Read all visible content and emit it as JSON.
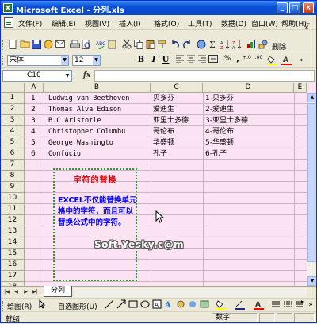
{
  "window": {
    "title": "Microsoft Excel - 分列.xls",
    "app_icon": "X",
    "controls": {
      "minimize": "_",
      "restore": "□",
      "close": "×"
    }
  },
  "menu": {
    "items": [
      "文件(F)",
      "编辑(E)",
      "视图(V)",
      "插入(I)",
      "格式(O)",
      "工具(T)",
      "数据(D)",
      "窗口(W)",
      "帮助(H)"
    ],
    "doc_controls": {
      "minimize": "_",
      "restore": "▫",
      "close": "×"
    }
  },
  "standard_toolbar": {
    "icons": [
      "new-icon",
      "open-icon",
      "save-icon",
      "permission-icon",
      "email-icon",
      "print-icon",
      "print-preview-icon",
      "spelling-icon",
      "research-icon",
      "cut-icon",
      "copy-icon",
      "paste-icon",
      "format-painter-icon",
      "undo-icon",
      "redo-icon",
      "hyperlink-icon",
      "autosum-icon",
      "sort-ascending-icon",
      "sort-descending-icon",
      "chart-wizard-icon",
      "drawing-icon"
    ],
    "extra_label": "删除"
  },
  "formatting_toolbar": {
    "font_name": "宋体",
    "font_size": "12",
    "bold": "B",
    "italic": "I",
    "underline": "U",
    "currency": "%",
    "comma": ",",
    "increase_decimal": "+.0",
    "decrease_decimal": ".00",
    "accent_fill": "#ffff00",
    "accent_font": "#ff0000"
  },
  "formula_bar": {
    "name_box": "C10",
    "fx": "fx",
    "formula": ""
  },
  "grid": {
    "columns": [
      "A",
      "B",
      "C",
      "D",
      "E"
    ],
    "rows": [
      "1",
      "2",
      "3",
      "4",
      "5",
      "6",
      "7",
      "8",
      "9",
      "10",
      "11",
      "12",
      "13",
      "14",
      "15",
      "16",
      "17",
      "18"
    ],
    "data": [
      {
        "a": "1",
        "b": "Ludwig van Beethoven",
        "c": "贝多芬",
        "d": "1-贝多芬"
      },
      {
        "a": "2",
        "b": "Thomas Alva Edison",
        "c": "爱迪生",
        "d": "2-爱迪生"
      },
      {
        "a": "3",
        "b": "B.C.Aristotle",
        "c": "亚里士多德",
        "d": "3-亚里士多德"
      },
      {
        "a": "4",
        "b": "Christopher Columbu",
        "c": "哥伦布",
        "d": "4-哥伦布"
      },
      {
        "a": "5",
        "b": "George Washingto",
        "c": "华盛顿",
        "d": "5-华盛顿"
      },
      {
        "a": "6",
        "b": "Confuciu",
        "c": "孔子",
        "d": "6-孔子"
      }
    ],
    "background": "#fbe3f4"
  },
  "textbox": {
    "title": "字符的替换",
    "body": "EXCEL不仅能替换单元格中的字符，而且可以替换公式中的字符。",
    "title_color": "#e00000",
    "body_color": "#0000ff",
    "border_color": "#2a9a2a"
  },
  "watermark": "Soft.Yesky.c@m",
  "sheet_tabs": {
    "nav": [
      "|◀",
      "◀",
      "▶",
      "▶|"
    ],
    "active": "分列"
  },
  "drawing_toolbar": {
    "draw_label": "绘图(R)",
    "autoshapes_label": "自选图形(U)"
  },
  "status_bar": {
    "status": "就绪",
    "num_indicator": "数字"
  }
}
